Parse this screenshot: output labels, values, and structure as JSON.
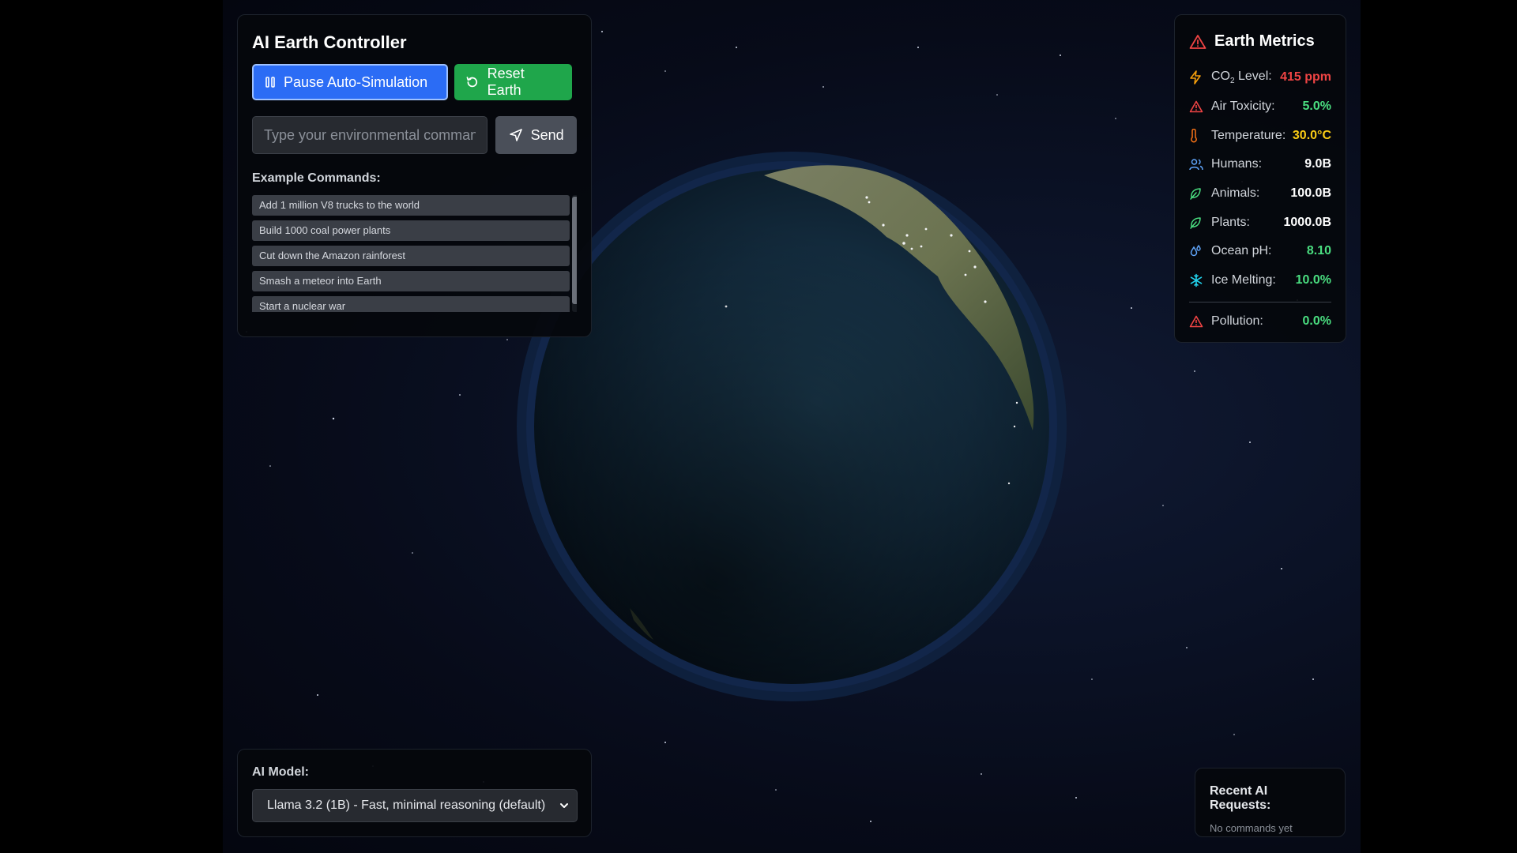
{
  "controller": {
    "title": "AI Earth Controller",
    "pause_label": "Pause Auto-Simulation",
    "reset_label": "Reset Earth",
    "command_placeholder": "Type your environmental command...",
    "send_label": "Send",
    "examples_title": "Example Commands:",
    "examples": [
      "Add 1 million V8 trucks to the world",
      "Build 1000 coal power plants",
      "Cut down the Amazon rainforest",
      "Smash a meteor into Earth",
      "Start a nuclear war"
    ]
  },
  "model": {
    "label": "AI Model:",
    "selected": "Llama 3.2 (1B) - Fast, minimal reasoning (default)"
  },
  "metrics": {
    "title": "Earth Metrics",
    "co2": {
      "label_prefix": "CO",
      "label_sub": "2",
      "label_suffix": " Level:",
      "value": "415 ppm",
      "color": "#ef4444"
    },
    "air": {
      "label": "Air Toxicity:",
      "value": "5.0%",
      "color": "#4ade80"
    },
    "temp": {
      "label": "Temperature:",
      "value": "30.0°C",
      "color": "#facc15"
    },
    "humans": {
      "label": "Humans:",
      "value": "9.0B",
      "color": "#ffffff"
    },
    "animals": {
      "label": "Animals:",
      "value": "100.0B",
      "color": "#ffffff"
    },
    "plants": {
      "label": "Plants:",
      "value": "1000.0B",
      "color": "#ffffff"
    },
    "ph": {
      "label": "Ocean pH:",
      "value": "8.10",
      "color": "#4ade80"
    },
    "ice": {
      "label": "Ice Melting:",
      "value": "10.0%",
      "color": "#4ade80"
    },
    "pollution": {
      "label": "Pollution:",
      "value": "0.0%",
      "color": "#4ade80"
    }
  },
  "recent": {
    "title": "Recent AI Requests:",
    "empty": "No commands yet"
  }
}
